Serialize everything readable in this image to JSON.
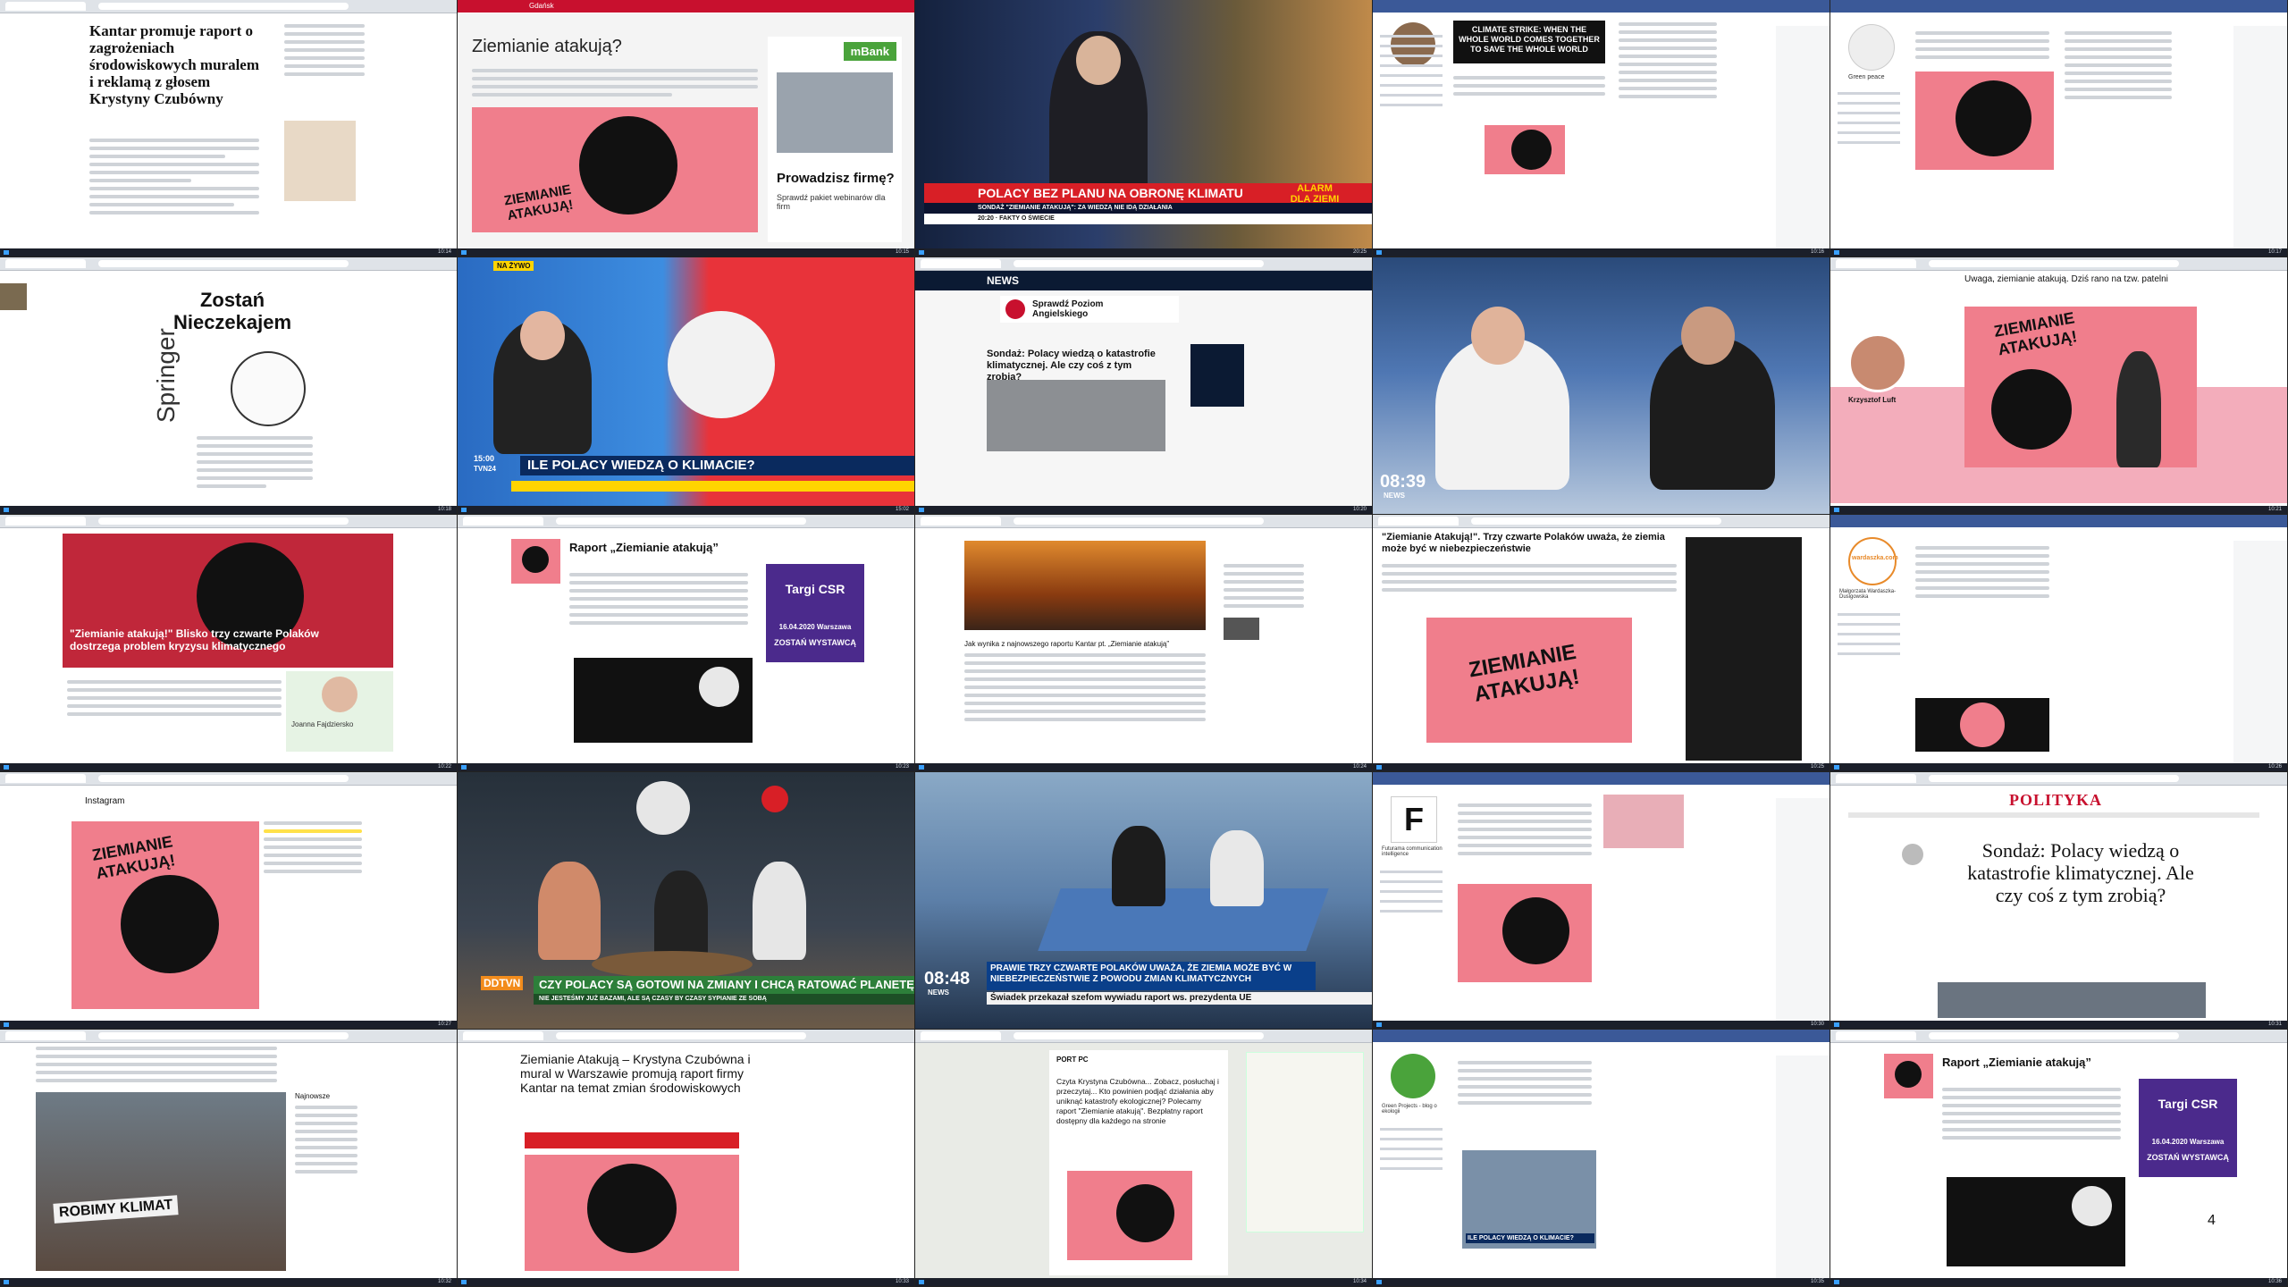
{
  "tiles": {
    "t1": {
      "headline": "Kantar promuje raport o zagrożeniach środowiskowych muralem i reklamą z głosem Krystyny Czubówny"
    },
    "t2": {
      "headline": "Ziemianie atakują?",
      "location": "Gdańsk",
      "ad_brand": "mBank",
      "ad_title": "Prowadzisz firmę?",
      "ad_sub": "Sprawdź pakiet webinarów dla firm"
    },
    "t3": {
      "ticker": "POLACY BEZ PLANU NA OBRONĘ KLIMATU",
      "subticker": "SONDAŻ \"ZIEMIANIE ATAKUJĄ\": ZA WIEDZĄ NIE IDĄ DZIAŁANIA",
      "show": "20:20 · FAKTY O ŚWIECIE",
      "alarm": "ALARM DLA ZIEMI"
    },
    "t4": {
      "banner": "CLIMATE STRIKE: WHEN THE WHOLE WORLD COMES TOGETHER TO SAVE THE WHOLE WORLD"
    },
    "t5": {
      "caption": "Green peace"
    },
    "t6": {
      "title": "Zostań Nieczekajem",
      "brand": "Springer"
    },
    "t7": {
      "ticker": "ILE POLACY WIEDZĄ O KLIMACIE?",
      "live": "NA ŻYWO",
      "time": "15:00",
      "tag": "TVN24"
    },
    "t8": {
      "channel": "NEWS",
      "ad": "Sprawdź Poziom Angielskiego",
      "headline": "Sondaż: Polacy wiedzą o katastrofie klimatycznej. Ale czy coś z tym zrobią?"
    },
    "t9": {
      "clock": "08:39",
      "channel": "NEWS"
    },
    "t10": {
      "post": "Uwaga, ziemianie atakują. Dziś rano na tzw. patelni",
      "name": "Krzysztof Luft"
    },
    "t11": {
      "caption": "\"Ziemianie atakują!\" Blisko trzy czwarte Polaków dostrzega problem kryzysu klimatycznego",
      "author": "Joanna Fajdziersko"
    },
    "t12": {
      "headline": "Raport „Ziemianie atakują”",
      "promo_title": "Targi CSR",
      "promo_date": "16.04.2020 Warszawa",
      "promo_cta": "ZOSTAŃ WYSTAWCĄ"
    },
    "t13": {
      "text": "Jak wynika z najnowszego raportu Kantar pt. „Ziemianie atakują”"
    },
    "t14": {
      "headline": "\"Ziemianie Atakują!\". Trzy czwarte Polaków uważa, że ziemia może być w niebezpieczeństwie",
      "poster": "ZIEMIANIE ATAKUJĄ!"
    },
    "t15": {
      "page": "wardaszka.com",
      "name": "Małgorzata Wardaszka-Dusigowska"
    },
    "t16": {
      "app": "Instagram",
      "poster": "ZIEMIANIE ATAKUJĄ!"
    },
    "t17": {
      "ticker": "CZY POLACY SĄ GOTOWI NA ZMIANY I CHCĄ RATOWAĆ PLANETĘ?",
      "sub": "NIE JESTEŚMY JUŻ BAZAMI, ALE SĄ CZASY BY CZASY SYPIANIE ZE SOBĄ",
      "logo": "DDTVN"
    },
    "t18": {
      "clock": "08:48",
      "ticker": "PRAWIE TRZY CZWARTE POLAKÓW UWAŻA, ŻE ZIEMIA MOŻE BYĆ W NIEBEZPIECZEŃSTWIE Z POWODU ZMIAN KLIMATYCZNYCH",
      "sub": "Świadek przekazał szefom wywiadu raport ws. prezydenta UE",
      "channel": "NEWS"
    },
    "t19": {
      "page": "Futurama communication intelligence"
    },
    "t20": {
      "brand": "POLITYKA",
      "headline": "Sondaż: Polacy wiedzą o katastrofie klimatycznej. Ale czy coś z tym zrobią?"
    },
    "t21": {
      "sign": "ROBIMY KLIMAT",
      "section": "Najnowsze"
    },
    "t22": {
      "headline": "Ziemianie Atakują – Krystyna Czubówna i mural w Warszawie promują raport firmy Kantar na temat zmian środowiskowych"
    },
    "t23": {
      "post": "Czyta Krystyna Czubówna... Zobacz, posłuchaj i przeczytaj... Kto powinien podjąć działania aby uniknąć katastrofy ekologicznej? Polecamy raport \"Ziemianie atakują\". Bezpłatny raport dostępny dla każdego na stronie",
      "brand": "PORT PC"
    },
    "t24": {
      "page": "Green Projects - blog o ekologii",
      "video_title": "ILE POLACY WIEDZĄ O KLIMACIE?"
    },
    "t25": {
      "headline": "Raport „Ziemianie atakują”",
      "promo_title": "Targi CSR",
      "promo_date": "16.04.2020 Warszawa",
      "promo_cta": "ZOSTAŃ WYSTAWCĄ",
      "page_no": "4"
    }
  },
  "colors": {
    "poster_pink": "#f07e8c",
    "facebook_blue": "#3b5998",
    "tv_red": "#d81f26",
    "csr_purple": "#4b2a8c"
  }
}
